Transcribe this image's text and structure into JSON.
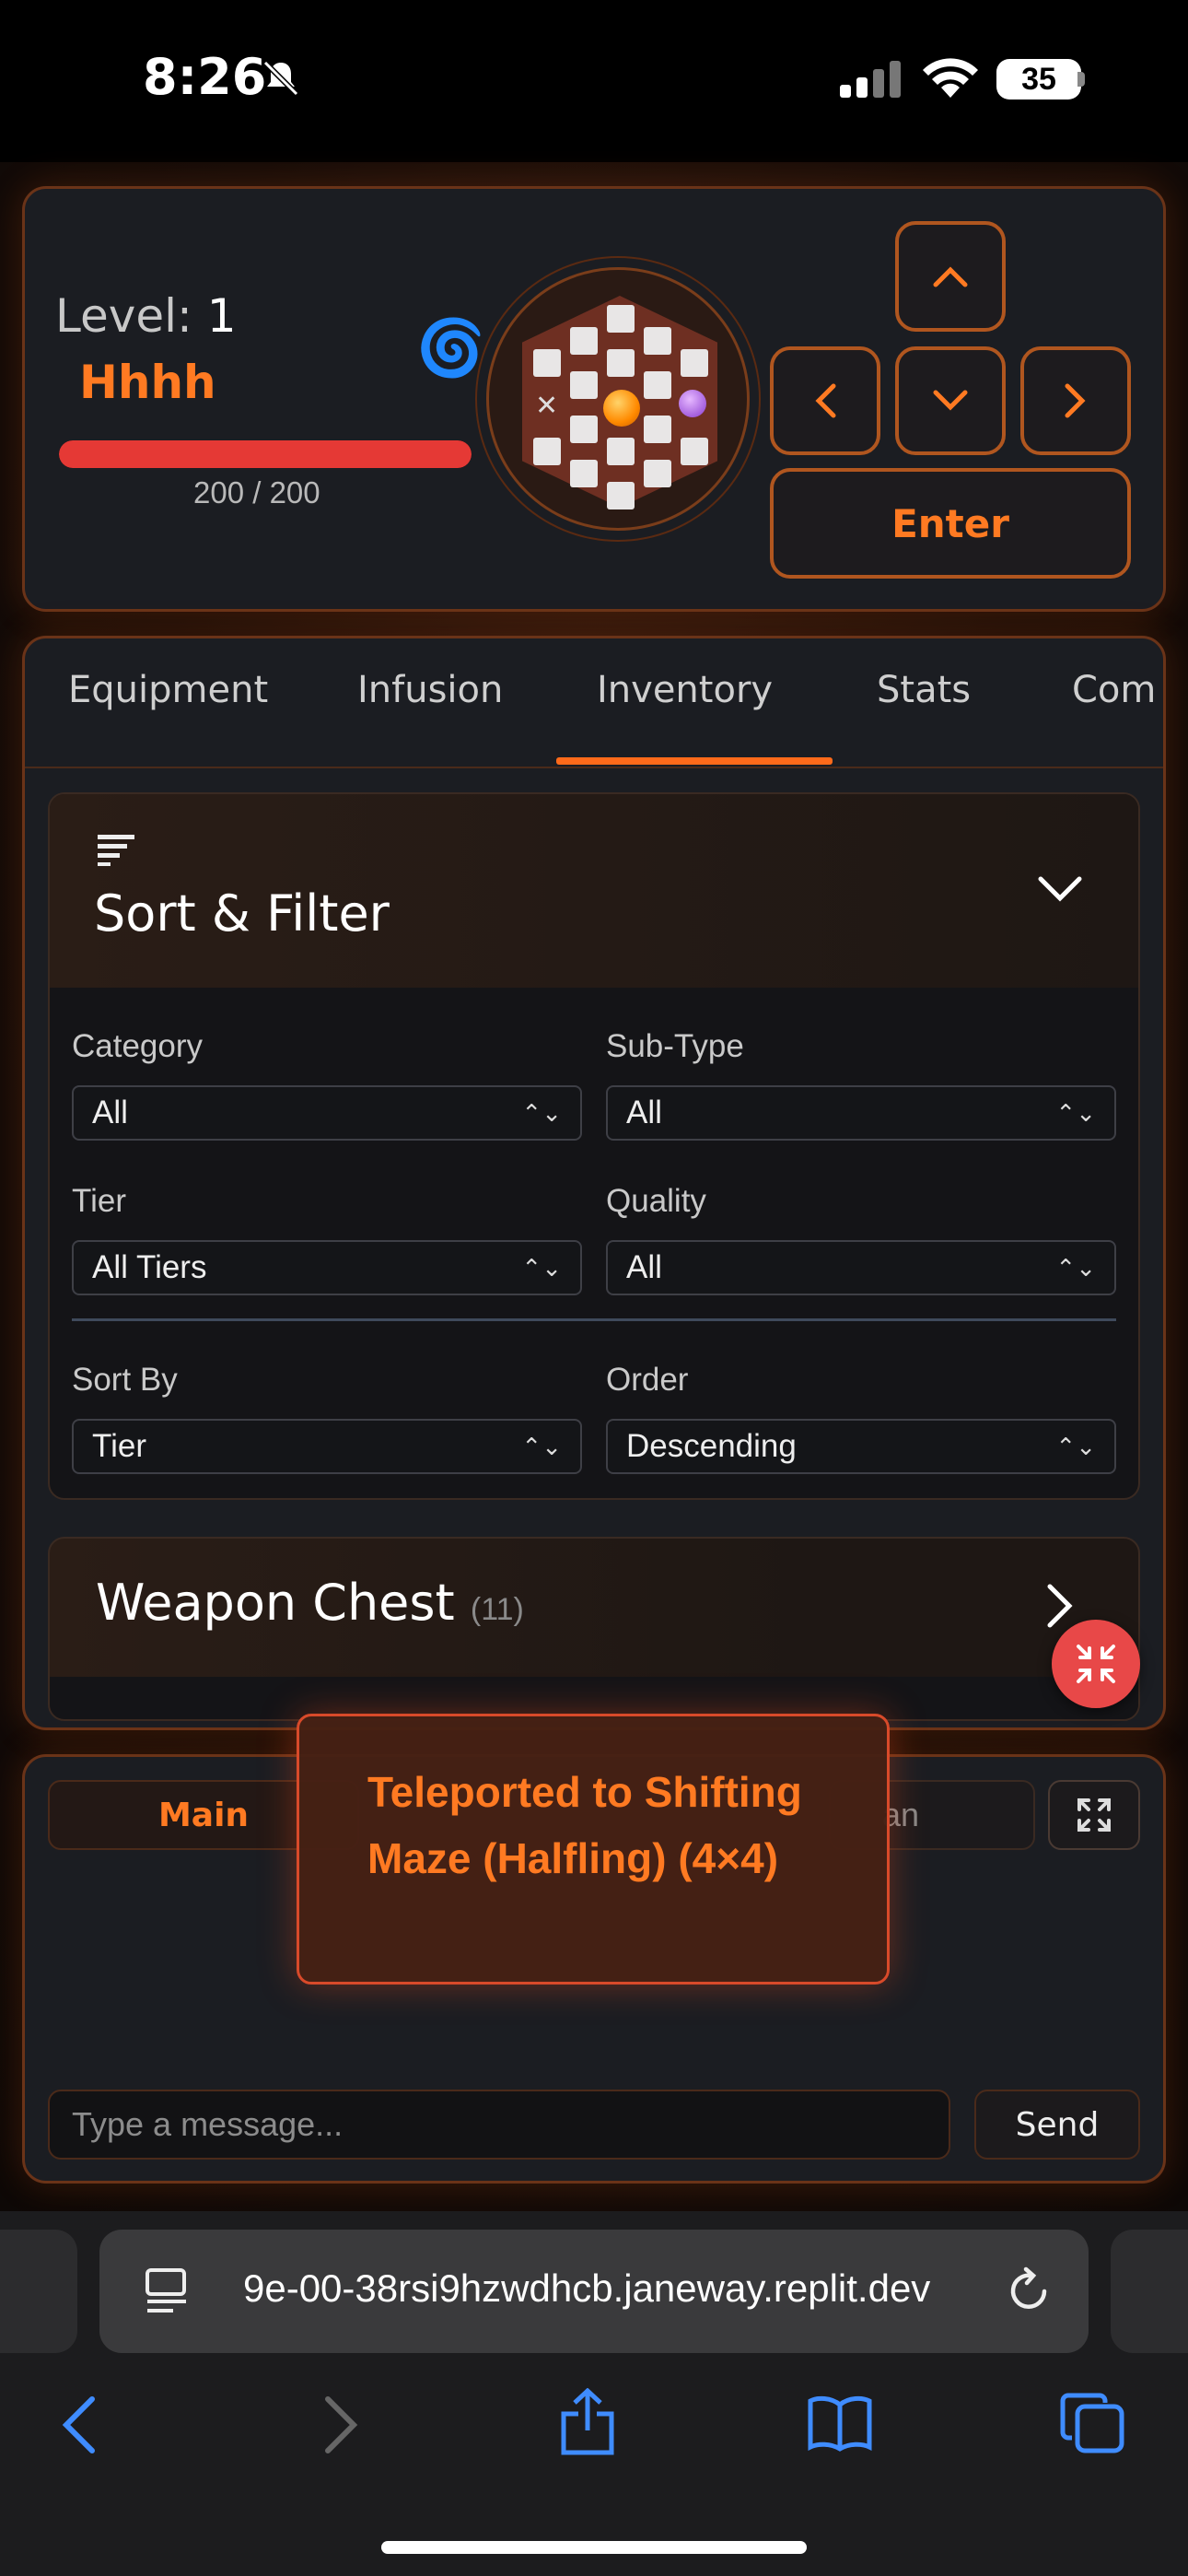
{
  "status_bar": {
    "time": "8:26",
    "battery": "35"
  },
  "hud": {
    "level_label": "Level:",
    "level_value": "1",
    "player_name": "Hhhh",
    "hp_text": "200 / 200",
    "hp_fraction": 1.0,
    "enter_label": "Enter"
  },
  "tabs": [
    {
      "label": "Equipment"
    },
    {
      "label": "Infusion"
    },
    {
      "label": "Inventory",
      "active": true
    },
    {
      "label": "Stats"
    },
    {
      "label": "Com"
    }
  ],
  "sort_filter": {
    "title": "Sort & Filter",
    "category_label": "Category",
    "category_value": "All",
    "subtype_label": "Sub-Type",
    "subtype_value": "All",
    "tier_label": "Tier",
    "tier_value": "All Tiers",
    "quality_label": "Quality",
    "quality_value": "All",
    "sortby_label": "Sort By",
    "sortby_value": "Tier",
    "order_label": "Order",
    "order_value": "Descending"
  },
  "weapon_chest": {
    "title": "Weapon Chest",
    "count": "(11)"
  },
  "chat": {
    "tab_main": "Main",
    "tab_other_partial": "an",
    "placeholder": "Type a message...",
    "send_label": "Send"
  },
  "toast": {
    "message": "Teleported to Shifting Maze (Halfling) (4×4)"
  },
  "browser": {
    "url": "9e-00-38rsi9hzwdhcb.janeway.replit.dev"
  },
  "colors": {
    "accent": "#ff7a22",
    "panel": "#1b1d22",
    "hp": "#e53935"
  }
}
